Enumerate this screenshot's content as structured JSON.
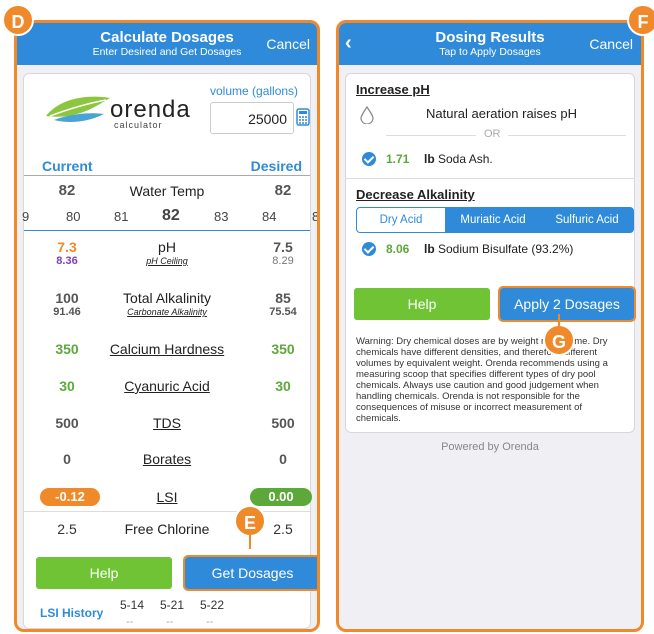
{
  "markers": {
    "d": "D",
    "e": "E",
    "f": "F",
    "g": "G"
  },
  "left": {
    "title": "Calculate Dosages",
    "subtitle": "Enter Desired and Get Dosages",
    "cancel": "Cancel",
    "logo_text": "orenda",
    "logo_sub": "calculator",
    "volume_label": "volume (gallons)",
    "volume_value": "25000",
    "current_label": "Current",
    "desired_label": "Desired",
    "water_temp": {
      "label": "Water Temp",
      "current": "82",
      "desired": "82"
    },
    "temp_picker": [
      "9",
      "80",
      "81",
      "82",
      "83",
      "84",
      "8"
    ],
    "ph": {
      "label": "pH",
      "sub": "pH Ceiling",
      "current": "7.3",
      "current_sub": "8.36",
      "desired": "7.5",
      "desired_sub": "8.29"
    },
    "alk": {
      "label": "Total Alkalinity",
      "sub": "Carbonate Alkalinity",
      "current": "100",
      "current_sub": "91.46",
      "desired": "85",
      "desired_sub": "75.54"
    },
    "calcium": {
      "label": "Calcium Hardness",
      "current": "350",
      "desired": "350"
    },
    "cya": {
      "label": "Cyanuric Acid",
      "current": "30",
      "desired": "30"
    },
    "tds": {
      "label": "TDS",
      "current": "500",
      "desired": "500"
    },
    "borates": {
      "label": "Borates",
      "current": "0",
      "desired": "0"
    },
    "lsi": {
      "label": "LSI",
      "current": "-0.12",
      "desired": "0.00"
    },
    "chlorine": {
      "label": "Free Chlorine",
      "current": "2.5",
      "desired": "2.5"
    },
    "help_label": "Help",
    "get_dosages_label": "Get Dosages",
    "lsi_history_label": "LSI History",
    "history_dates": [
      "5-14",
      "5-21",
      "5-22"
    ],
    "history_values": [
      "--",
      "--",
      "--"
    ]
  },
  "right": {
    "title": "Dosing Results",
    "subtitle": "Tap to Apply Dosages",
    "cancel": "Cancel",
    "increase_ph": "Increase pH",
    "aeration_text": "Natural aeration raises pH",
    "or_text": "OR",
    "soda_amount": "1.71",
    "soda_unit": "lb",
    "soda_name": "Soda Ash.",
    "decrease_alk": "Decrease Alkalinity",
    "acid_tabs": [
      "Dry Acid",
      "Muriatic Acid",
      "Sulfuric Acid"
    ],
    "bisulfate_amount": "8.06",
    "bisulfate_unit": "lb",
    "bisulfate_name": "Sodium Bisulfate (93.2%)",
    "help_label": "Help",
    "apply_label": "Apply 2 Dosages",
    "warning": "Warning: Dry chemical doses are by weight not volume. Dry chemicals have different densities, and therefore different volumes by equivalent weight. Orenda recommends using a measuring scoop that specifies different types of dry pool chemicals. Always use caution and good judgement when handling chemicals. Orenda is not responsible for the consequences of misuse or incorrect measurement of chemicals.",
    "powered_by": "Powered by Orenda"
  },
  "colors": {
    "accent": "#2f8bd9",
    "orange": "#f0892a",
    "green": "#5ca83a",
    "purple": "#7b3fb5"
  }
}
